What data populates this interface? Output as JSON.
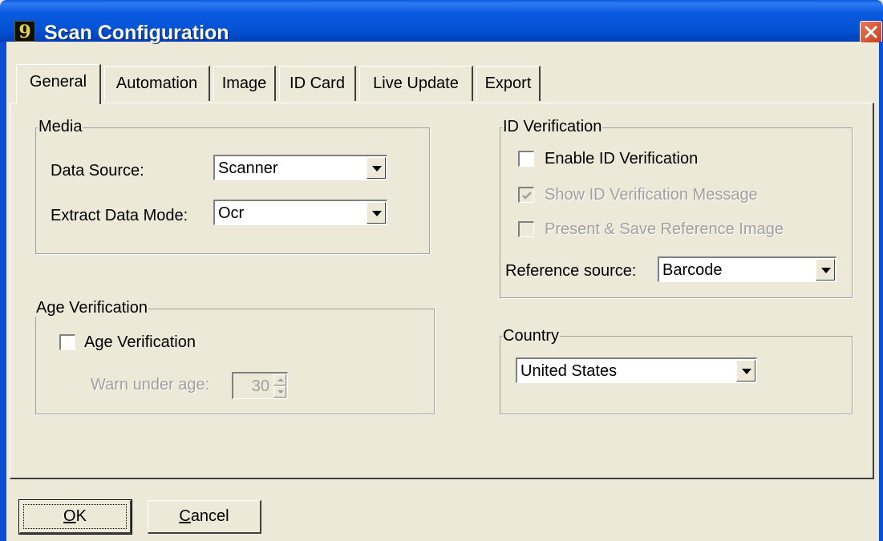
{
  "window": {
    "title": "Scan Configuration",
    "app_icon_glyph": "9"
  },
  "tabs": [
    {
      "label": "General"
    },
    {
      "label": "Automation"
    },
    {
      "label": "Image"
    },
    {
      "label": "ID Card"
    },
    {
      "label": "Live Update"
    },
    {
      "label": "Export"
    }
  ],
  "media": {
    "title": "Media",
    "data_source_label": "Data Source:",
    "data_source_value": "Scanner",
    "extract_mode_label": "Extract Data Mode:",
    "extract_mode_value": "Ocr"
  },
  "age": {
    "title": "Age Verification",
    "checkbox_label": "Age Verification",
    "checked": false,
    "warn_label": "Warn under age:",
    "warn_value": "30"
  },
  "idv": {
    "title": "ID Verification",
    "enable_label": "Enable ID Verification",
    "enable_checked": false,
    "show_msg_label": "Show ID Verification Message",
    "show_msg_checked": true,
    "present_label": "Present & Save  Reference Image",
    "present_checked": false,
    "ref_source_label": "Reference source:",
    "ref_source_value": "Barcode"
  },
  "country": {
    "title": "Country",
    "value": "United States"
  },
  "buttons": {
    "ok_mnemonic": "O",
    "ok_rest": "K",
    "cancel_mnemonic": "C",
    "cancel_rest": "ancel"
  },
  "colors": {
    "title_bar": "#0a5ae0",
    "dialog_bg": "#ece9d8",
    "close_button": "#d9522e"
  }
}
